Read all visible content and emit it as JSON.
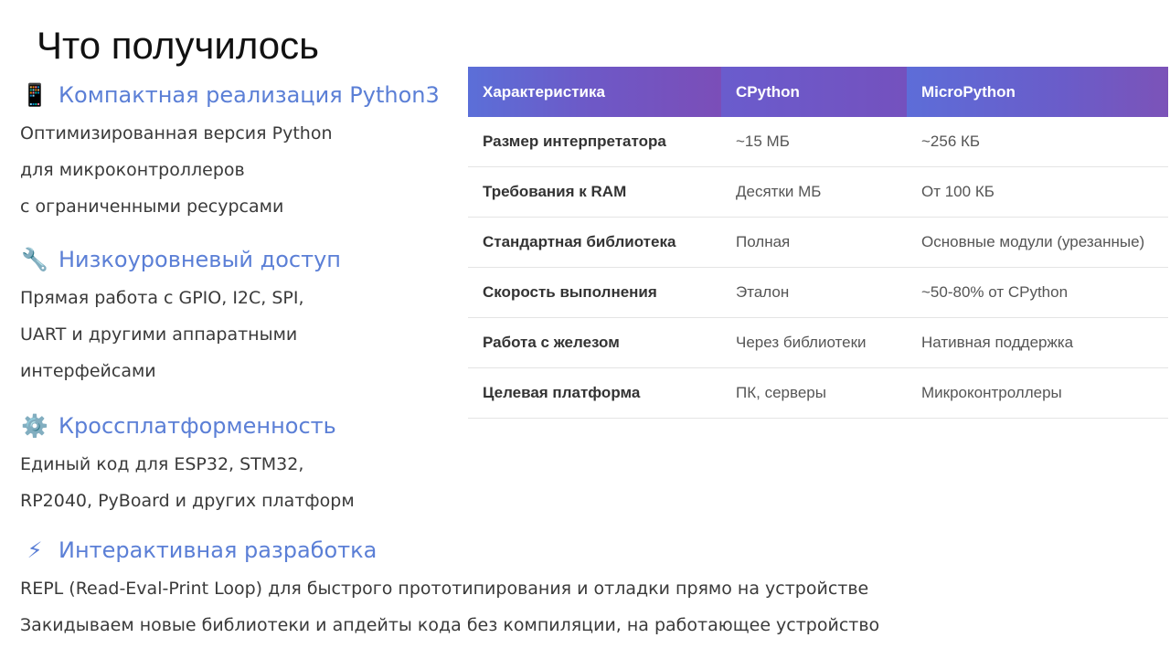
{
  "slide": {
    "title": "Что получилось",
    "sections": [
      {
        "icon": "mobile-phone-icon",
        "emoji": "📱",
        "heading": "Компактная реализация Python3",
        "lines": [
          "Оптимизированная версия Python",
          "для микроконтроллеров",
          "с ограниченными ресурсами"
        ]
      },
      {
        "icon": "wrench-icon",
        "emoji": "🔧",
        "heading": "Низкоуровневый доступ",
        "lines": [
          "Прямая работа с GPIO, I2C, SPI,",
          "UART и другими аппаратными",
          "интерфейсами"
        ]
      },
      {
        "icon": "gear-icon",
        "emoji": "⚙️",
        "heading": "Кроссплатформенность",
        "lines": [
          "Единый код для ESP32, STM32,",
          "RP2040, PyBoard и других платформ"
        ]
      },
      {
        "icon": "lightning-icon",
        "emoji": "⚡",
        "heading": "Интерактивная разработка",
        "lines": [
          "REPL (Read-Eval-Print Loop) для быстрого прототипирования и отладки прямо на устройстве",
          "Закидываем новые библиотеки и апдейты кода без компиляции, на работающее устройство"
        ]
      }
    ]
  },
  "table": {
    "headers": [
      "Характеристика",
      "CPython",
      "MicroPython"
    ],
    "rows": [
      [
        "Размер интерпретатора",
        "~15 МБ",
        "~256 КБ"
      ],
      [
        "Требования к RAM",
        "Десятки МБ",
        "От 100 КБ"
      ],
      [
        "Стандартная библиотека",
        "Полная",
        "Основные модули (урезанные)"
      ],
      [
        "Скорость выполнения",
        "Эталон",
        "~50-80% от CPython"
      ],
      [
        "Работа с железом",
        "Через библиотеки",
        "Нативная поддержка"
      ],
      [
        "Целевая платформа",
        "ПК, серверы",
        "Микроконтроллеры"
      ]
    ]
  }
}
